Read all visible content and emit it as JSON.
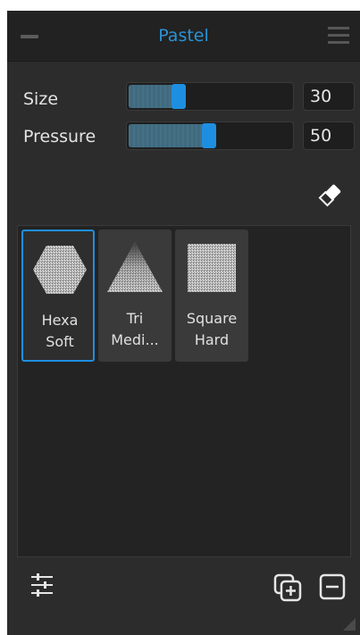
{
  "panel": {
    "title": "Pastel",
    "accent_color": "#2a93d6",
    "collapse_icon": "minus-icon",
    "menu_icon": "hamburger-menu-icon"
  },
  "sliders": [
    {
      "label": "Size",
      "value": "30",
      "fill_fraction": 0.3
    },
    {
      "label": "Pressure",
      "value": "50",
      "fill_fraction": 0.5
    }
  ],
  "eraser_icon": "eraser-icon",
  "brushes": [
    {
      "line1": "Hexa",
      "line2": "Soft",
      "shape": "hexagon",
      "selected": true
    },
    {
      "line1": "Tri",
      "line2": "Medi...",
      "shape": "triangle",
      "selected": false
    },
    {
      "line1": "Square",
      "line2": "Hard",
      "shape": "square",
      "selected": false
    }
  ],
  "footer": {
    "settings_icon": "sliders-icon",
    "duplicate_icon": "duplicate-icon",
    "remove_icon": "remove-icon"
  }
}
